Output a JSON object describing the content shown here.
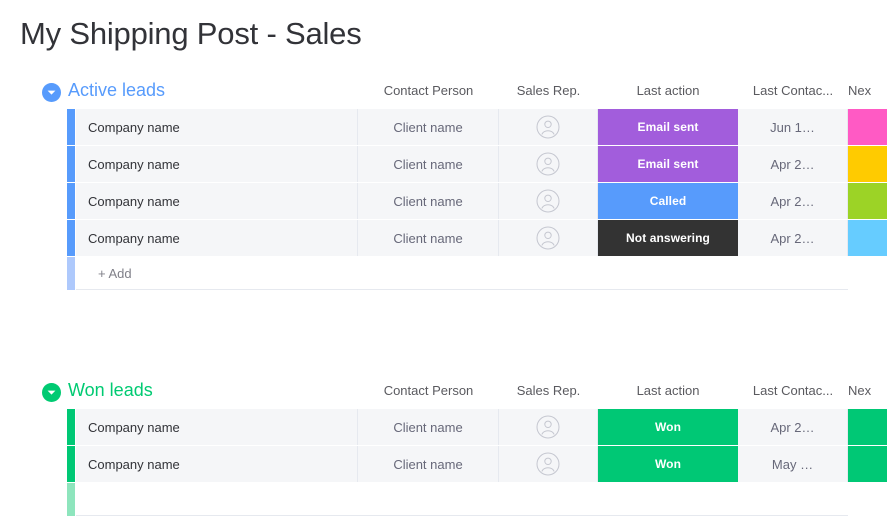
{
  "page": {
    "title": "My Shipping Post - Sales"
  },
  "columns": [
    {
      "key": "name",
      "label": ""
    },
    {
      "key": "contact",
      "label": "Contact Person"
    },
    {
      "key": "rep",
      "label": "Sales Rep."
    },
    {
      "key": "status",
      "label": "Last action"
    },
    {
      "key": "lastcontact",
      "label": "Last Contac..."
    },
    {
      "key": "next",
      "label": "Nex"
    }
  ],
  "colors": {
    "accent_blue": "#579bfc",
    "accent_green": "#00ca72",
    "purple": "#a25ddc",
    "blue": "#579bfc",
    "dark": "#333333",
    "green": "#00c875",
    "pink": "#ff5ac4",
    "yellow": "#ffcb00",
    "lime": "#9cd326",
    "lightblue": "#66ccff",
    "row_bg": "#f5f6f8",
    "add_bar_blue": "#aec9fc",
    "add_bar_green": "#8ee5bd"
  },
  "groups": [
    {
      "id": "active-leads",
      "title": "Active leads",
      "color": "#579bfc",
      "chevron_icon": "chevron-down-icon",
      "add_label": "+ Add",
      "rows": [
        {
          "name": "Company name",
          "contact": "Client name",
          "rep_icon": "person-avatar-icon",
          "status": "Email sent",
          "status_color": "#a25ddc",
          "lastcontact": "Jun 1…",
          "next_color": "#ff5ac4"
        },
        {
          "name": "Company name",
          "contact": "Client name",
          "rep_icon": "person-avatar-icon",
          "status": "Email sent",
          "status_color": "#a25ddc",
          "lastcontact": "Apr 2…",
          "next_color": "#ffcb00"
        },
        {
          "name": "Company name",
          "contact": "Client name",
          "rep_icon": "person-avatar-icon",
          "status": "Called",
          "status_color": "#579bfc",
          "lastcontact": "Apr 2…",
          "next_color": "#9cd326"
        },
        {
          "name": "Company name",
          "contact": "Client name",
          "rep_icon": "person-avatar-icon",
          "status": "Not answering",
          "status_color": "#333333",
          "lastcontact": "Apr 2…",
          "next_color": "#66ccff"
        }
      ]
    },
    {
      "id": "won-leads",
      "title": "Won leads",
      "color": "#00ca72",
      "chevron_icon": "chevron-down-icon",
      "add_label": "",
      "rows": [
        {
          "name": "Company name",
          "contact": "Client name",
          "rep_icon": "person-avatar-icon",
          "status": "Won",
          "status_color": "#00c875",
          "lastcontact": "Apr 2…",
          "next_color": "#00c875"
        },
        {
          "name": "Company name",
          "contact": "Client name",
          "rep_icon": "person-avatar-icon",
          "status": "Won",
          "status_color": "#00c875",
          "lastcontact": "May …",
          "next_color": "#00c875"
        }
      ]
    }
  ]
}
